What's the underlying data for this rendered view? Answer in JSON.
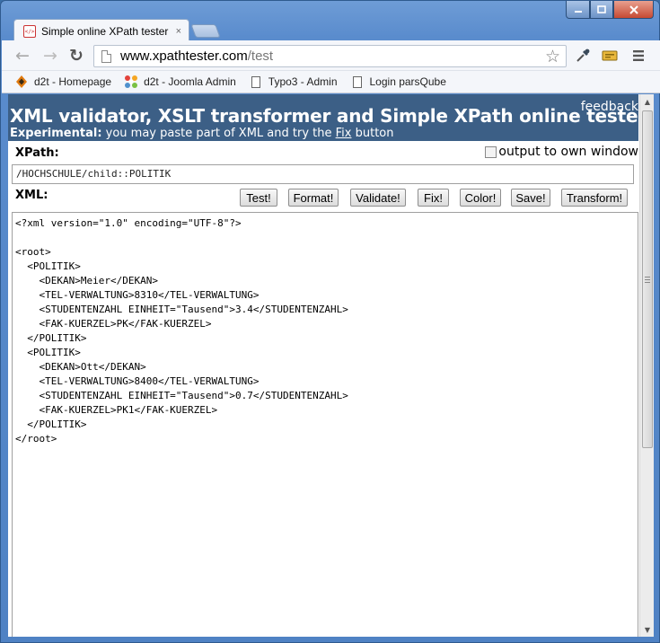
{
  "window": {
    "minimize_icon": "minimize-icon",
    "maximize_icon": "maximize-icon",
    "close_icon": "close-icon"
  },
  "tab": {
    "title": "Simple online XPath tester",
    "favicon_text": "</>",
    "close": "×"
  },
  "toolbar": {
    "back": "←",
    "forward": "→",
    "reload": "↻",
    "url_host": "www.xpathtester.com",
    "url_path": "/test",
    "star": "☆"
  },
  "bookmarks": [
    {
      "label": "d2t - Homepage",
      "icon": "d2t-icon"
    },
    {
      "label": "d2t - Joomla Admin",
      "icon": "joomla-icon"
    },
    {
      "label": "Typo3 - Admin",
      "icon": "page-icon"
    },
    {
      "label": "Login parsQube",
      "icon": "page-icon"
    }
  ],
  "page": {
    "title": "XML validator, XSLT transformer and Simple XPath online tester",
    "feedback": "feedback",
    "sub_bold": "Experimental:",
    "sub_text": " you may paste part of XML and try the ",
    "sub_link": "Fix",
    "sub_end": " button",
    "xpath_label": "XPath:",
    "own_window_label": "output to own window",
    "xpath_value": "/HOCHSCHULE/child::POLITIK",
    "xml_label": "XML:",
    "buttons": {
      "test": "Test!",
      "format": "Format!",
      "validate": "Validate!",
      "fix": "Fix!",
      "color": "Color!",
      "save": "Save!",
      "transform": "Transform!"
    },
    "xml_lines": [
      "<?xml version=\"1.0\" encoding=\"UTF-8\"?>",
      "",
      "<root>",
      "  <POLITIK>",
      "    <DEKAN>Meier</DEKAN>",
      "    <TEL-VERWALTUNG>8310</TEL-VERWALTUNG>",
      "    <STUDENTENZAHL EINHEIT=\"Tausend\">3.4</STUDENTENZAHL>",
      "    <FAK-KUERZEL>PK</FAK-KUERZEL>",
      "  </POLITIK>",
      "  <POLITIK>",
      "    <DEKAN>Ott</DEKAN>",
      "    <TEL-VERWALTUNG>8400</TEL-VERWALTUNG>",
      "    <STUDENTENZAHL EINHEIT=\"Tausend\">0.7</STUDENTENZAHL>",
      "    <FAK-KUERZEL>PK1</FAK-KUERZEL>",
      "  </POLITIK>",
      "</root>"
    ]
  },
  "colors": {
    "header_bg": "#3c5f86",
    "window_frame": "#5a8ccd"
  }
}
